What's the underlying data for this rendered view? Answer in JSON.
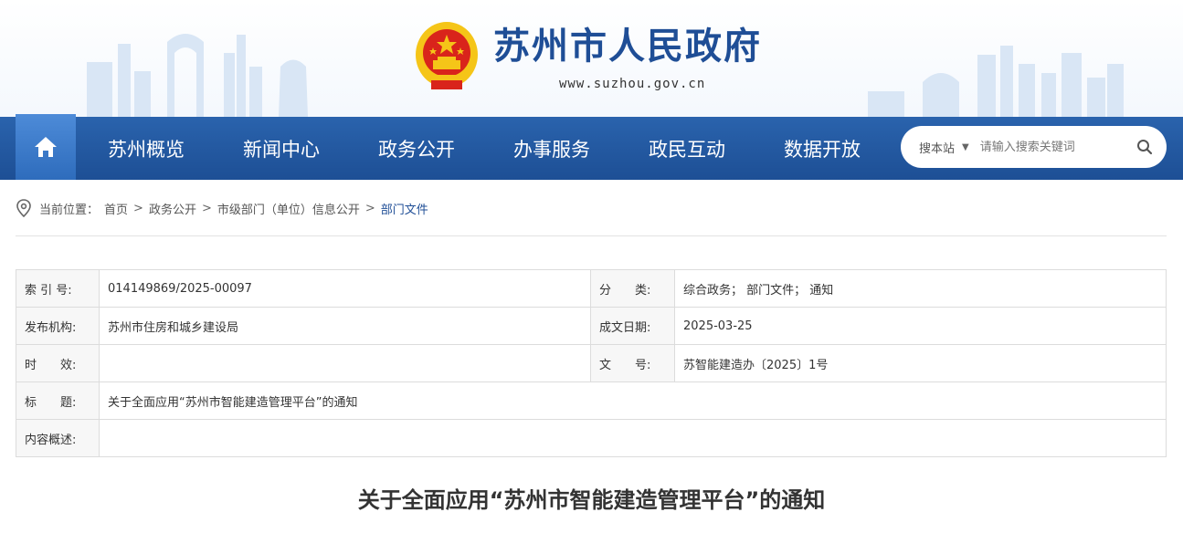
{
  "header": {
    "site_title": "苏州市人民政府",
    "site_url": "www.suzhou.gov.cn"
  },
  "nav": {
    "items": [
      {
        "label": "苏州概览"
      },
      {
        "label": "新闻中心"
      },
      {
        "label": "政务公开"
      },
      {
        "label": "办事服务"
      },
      {
        "label": "政民互动"
      },
      {
        "label": "数据开放"
      }
    ],
    "search": {
      "scope": "搜本站",
      "placeholder": "请输入搜索关键词"
    }
  },
  "breadcrumb": {
    "prefix": "当前位置：",
    "items": [
      "首页",
      "政务公开",
      "市级部门（单位）信息公开",
      "部门文件"
    ],
    "separator": ">"
  },
  "info": {
    "index_label": "索 引 号:",
    "index_value": "014149869/2025-00097",
    "category_label": "分　　类:",
    "category_value": "综合政务； 部门文件； 通知",
    "publisher_label": "发布机构:",
    "publisher_value": "苏州市住房和城乡建设局",
    "date_label": "成文日期:",
    "date_value": "2025-03-25",
    "validity_label": "时　　效:",
    "validity_value": "",
    "docno_label": "文　　号:",
    "docno_value": "苏智能建造办〔2025〕1号",
    "title_label": "标　　题:",
    "title_value": "关于全面应用“苏州市智能建造管理平台”的通知",
    "summary_label": "内容概述:",
    "summary_value": ""
  },
  "document": {
    "title": "关于全面应用“苏州市智能建造管理平台”的通知"
  },
  "colors": {
    "brand_blue": "#1f4e96",
    "nav_blue": "#2a63ad",
    "home_tab": "#3e7ccb",
    "emblem_red": "#d9241b",
    "emblem_gold": "#f5c518"
  }
}
